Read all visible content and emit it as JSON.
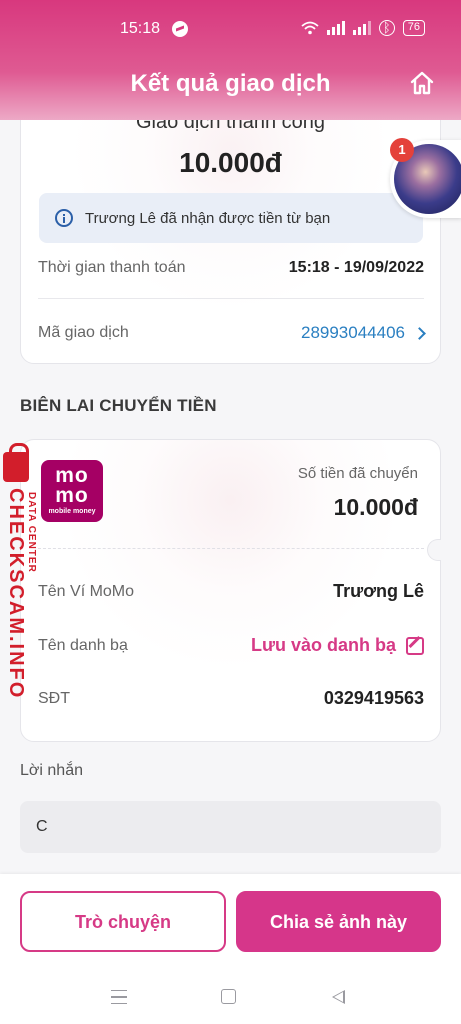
{
  "status_bar": {
    "time": "15:18",
    "battery": "76"
  },
  "header": {
    "title": "Kết quả giao dịch"
  },
  "result_card": {
    "status_text": "Giao dịch thành công",
    "amount": "10.000đ",
    "info_message": "Trương Lê đã nhận được tiền từ bạn",
    "payment_time_label": "Thời gian thanh toán",
    "payment_time_value": "15:18 - 19/09/2022",
    "transaction_id_label": "Mã giao dịch",
    "transaction_id_value": "28993044406",
    "notification_badge": "1"
  },
  "receipt": {
    "section_title": "BIÊN LAI CHUYỂN TIỀN",
    "logo_text": "mo mo",
    "logo_subtext": "mobile money",
    "sent_amount_label": "Số tiền đã chuyển",
    "sent_amount_value": "10.000đ",
    "wallet_name_label": "Tên Ví MoMo",
    "wallet_name_value": "Trương Lê",
    "contact_name_label": "Tên danh bạ",
    "contact_name_action": "Lưu vào danh bạ",
    "phone_label": "SĐT",
    "phone_value": "0329419563"
  },
  "message": {
    "label": "Lời nhắn",
    "value": "C"
  },
  "actions": {
    "chat_button": "Trò chuyện",
    "share_button": "Chia sẻ ảnh này"
  },
  "watermark": {
    "text": "CHECKSCAM.INFO",
    "subtext": "DATA CENTER"
  },
  "colors": {
    "brand_pink": "#d6368a",
    "momo_logo": "#a50064",
    "link_blue": "#2a7fc1",
    "watermark_red": "#d21e2b"
  }
}
